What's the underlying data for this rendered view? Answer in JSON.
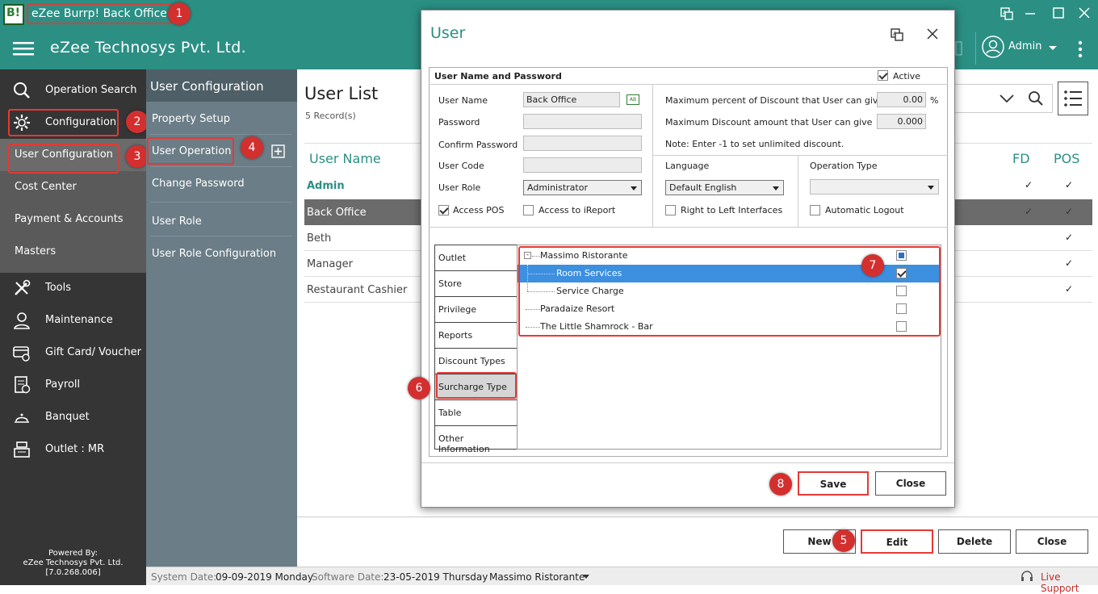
{
  "window": {
    "title": "eZee Burrp! Back Office",
    "icon_text": "B!"
  },
  "header": {
    "company": "eZee Technosys Pvt. Ltd.",
    "user": "Admin"
  },
  "sidebar": {
    "items": [
      {
        "label": "Operation Search",
        "icon": "search-icon"
      },
      {
        "label": "Configuration",
        "icon": "gear-icon"
      },
      {
        "label": "User Configuration"
      },
      {
        "label": "Cost Center"
      },
      {
        "label": "Payment & Accounts"
      },
      {
        "label": "Masters"
      },
      {
        "label": "Tools",
        "icon": "tools-icon"
      },
      {
        "label": "Maintenance",
        "icon": "maintenance-icon"
      },
      {
        "label": "Gift Card/ Voucher",
        "icon": "gift-card-icon"
      },
      {
        "label": "Payroll",
        "icon": "payroll-icon"
      },
      {
        "label": "Banquet",
        "icon": "banquet-icon"
      },
      {
        "label": "Outlet : MR",
        "icon": "cash-register-icon"
      }
    ],
    "powered_by": [
      "Powered By:",
      "eZee Technosys Pvt. Ltd.",
      "[7.0.268.006]"
    ]
  },
  "panel2": {
    "title": "User Configuration",
    "items": [
      "Property Setup",
      "User Operation",
      "Change Password",
      "User Role",
      "User Role Configuration"
    ]
  },
  "user_list": {
    "title": "User List",
    "count": "5 Record(s)",
    "columns": [
      "User Name",
      "FD",
      "POS"
    ],
    "rows": [
      {
        "name": "Admin",
        "fd": "✓",
        "pos": "✓"
      },
      {
        "name": "Back Office",
        "fd": "✓",
        "pos": "✓"
      },
      {
        "name": "Beth",
        "fd": "",
        "pos": "✓"
      },
      {
        "name": "Manager",
        "fd": "",
        "pos": "✓"
      },
      {
        "name": "Restaurant Cashier",
        "fd": "",
        "pos": "✓"
      }
    ]
  },
  "bottom_buttons": {
    "new": "New",
    "edit": "Edit",
    "delete": "Delete",
    "close": "Close"
  },
  "status": {
    "system_date_label": "System Date:",
    "system_date": "09-09-2019 Monday",
    "software_date_label": "Software Date:",
    "software_date": "23-05-2019 Thursday",
    "outlet": "Massimo Ristorante",
    "live_support": "Live Support"
  },
  "dialog": {
    "title": "User",
    "section_title": "User Name and Password",
    "active_label": "Active",
    "active": true,
    "fields": {
      "user_name_label": "User Name",
      "user_name": "Back Office",
      "password_label": "Password",
      "confirm_password_label": "Confirm Password",
      "user_code_label": "User Code",
      "user_role_label": "User Role",
      "user_role": "Administrator",
      "access_pos_label": "Access POS",
      "access_pos": true,
      "access_ireport_label": "Access to iReport",
      "access_ireport": false
    },
    "discount": {
      "max_percent_label": "Maximum percent of Discount that User can give",
      "max_percent": "0.00",
      "percent_sign": "%",
      "max_amount_label": "Maximum Discount amount that User can give",
      "max_amount": "0.000",
      "note": "Note: Enter -1 to set unlimited discount."
    },
    "language": {
      "label": "Language",
      "value": "Default English",
      "rtl_label": "Right to Left Interfaces"
    },
    "operation_type": {
      "label": "Operation Type",
      "value": "",
      "auto_logout_label": "Automatic Logout"
    },
    "tabs": [
      "Outlet",
      "Store",
      "Privilege",
      "Reports",
      "Discount Types",
      "Surcharge Type",
      "Table",
      "Other Information"
    ],
    "active_tab": "Surcharge Type",
    "tree": [
      {
        "label": "Massimo Ristorante",
        "level": 0,
        "state": "partial"
      },
      {
        "label": "Room Services",
        "level": 1,
        "state": "checked",
        "selected": true
      },
      {
        "label": "Service Charge",
        "level": 1,
        "state": "unchecked"
      },
      {
        "label": "Paradaize Resort",
        "level": 0,
        "state": "unchecked"
      },
      {
        "label": "The Little Shamrock - Bar",
        "level": 0,
        "state": "unchecked"
      }
    ],
    "save": "Save",
    "close": "Close"
  },
  "annotations": [
    "1",
    "2",
    "3",
    "4",
    "5",
    "6",
    "7",
    "8"
  ],
  "colors": {
    "teal": "#2b8f84",
    "sidebar": "#353535",
    "panel": "#6b7d86",
    "accent_red": "#e53935",
    "selection": "#3d8fe0"
  }
}
